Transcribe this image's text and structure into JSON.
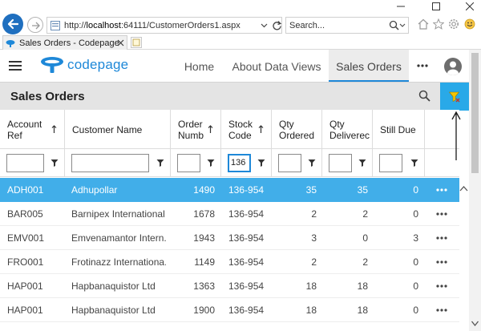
{
  "browser": {
    "url_prefix": "http://",
    "url_host": "localhost",
    "url_rest": ":64111/CustomerOrders1.aspx",
    "search_placeholder": "Search...",
    "tab_title": "Sales Orders - Codepage"
  },
  "app": {
    "logo_text": "codepage",
    "nav": [
      "Home",
      "About Data Views",
      "Sales Orders"
    ],
    "active_nav": "Sales Orders"
  },
  "page": {
    "title": "Sales Orders"
  },
  "grid": {
    "columns": [
      {
        "label": "Account\nRef",
        "sorted": true
      },
      {
        "label": "Customer Name",
        "sorted": false
      },
      {
        "label": "Order\nNumb",
        "sorted": true
      },
      {
        "label": "Stock\nCode",
        "sorted": true
      },
      {
        "label": "Qty\nOrdered",
        "sorted": false
      },
      {
        "label": "Qty\nDeliverec",
        "sorted": false
      },
      {
        "label": "Still Due",
        "sorted": false
      }
    ],
    "filters": [
      "",
      "",
      "",
      "136",
      "",
      "",
      ""
    ],
    "rows": [
      {
        "account": "ADH001",
        "customer": "Adhupollar",
        "order": "1490",
        "stock": "136-954",
        "ordered": "35",
        "delivered": "35",
        "due": "0",
        "selected": true
      },
      {
        "account": "BAR005",
        "customer": "Barnipex International",
        "order": "1678",
        "stock": "136-954",
        "ordered": "2",
        "delivered": "2",
        "due": "0",
        "selected": false
      },
      {
        "account": "EMV001",
        "customer": "Emvenamantor Intern...",
        "order": "1943",
        "stock": "136-954",
        "ordered": "3",
        "delivered": "0",
        "due": "3",
        "selected": false
      },
      {
        "account": "FRO001",
        "customer": "Frotinazz Internationa...",
        "order": "1149",
        "stock": "136-954",
        "ordered": "2",
        "delivered": "2",
        "due": "0",
        "selected": false
      },
      {
        "account": "HAP001",
        "customer": "Hapbanaquistor Ltd",
        "order": "1363",
        "stock": "136-954",
        "ordered": "18",
        "delivered": "18",
        "due": "0",
        "selected": false
      },
      {
        "account": "HAP001",
        "customer": "Hapbanaquistor Ltd",
        "order": "1900",
        "stock": "136-954",
        "ordered": "18",
        "delivered": "18",
        "due": "0",
        "selected": false
      }
    ]
  },
  "colors": {
    "accent": "#1e88d8",
    "selected_row": "#41aee9",
    "filter_button": "#29a9e8"
  },
  "icons": {
    "back": "back-arrow-icon",
    "forward": "forward-arrow-icon",
    "search": "search-icon",
    "filter": "filter-icon",
    "clear_filter": "clear-filter-icon",
    "more": "more-horizontal-icon",
    "user": "user-avatar-icon",
    "menu": "hamburger-menu-icon",
    "sort": "sort-ascending-icon"
  }
}
